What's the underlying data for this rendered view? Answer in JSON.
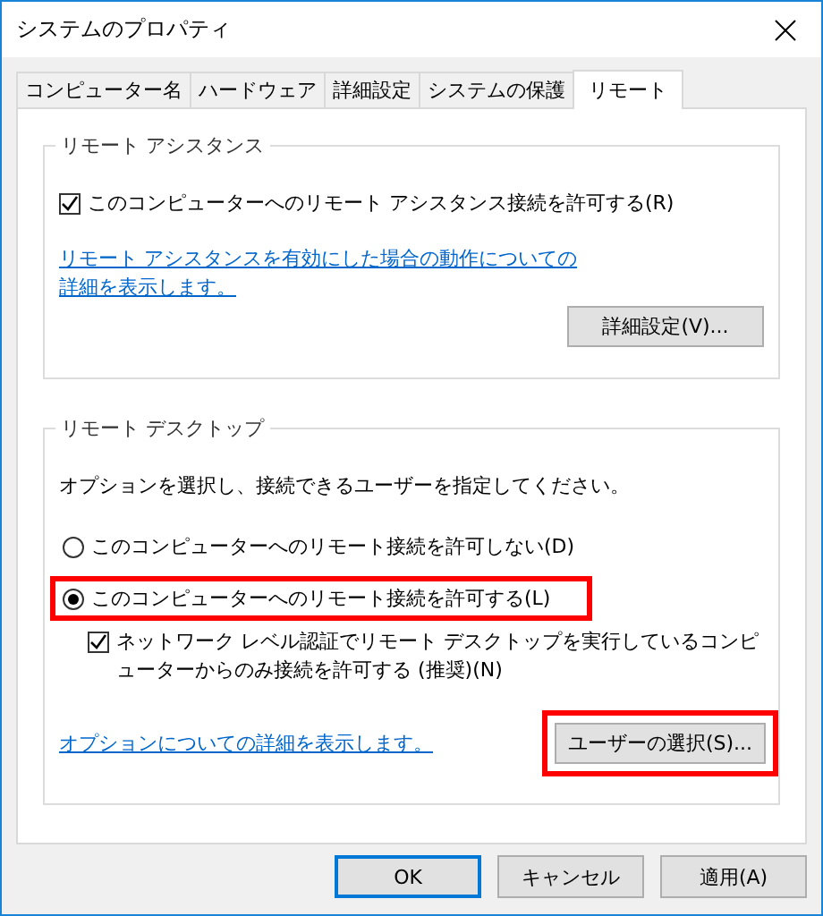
{
  "window": {
    "title": "システムのプロパティ"
  },
  "tabs": [
    {
      "label": "コンピューター名",
      "selected": false
    },
    {
      "label": "ハードウェア",
      "selected": false
    },
    {
      "label": "詳細設定",
      "selected": false
    },
    {
      "label": "システムの保護",
      "selected": false
    },
    {
      "label": "リモート",
      "selected": true
    }
  ],
  "remote_assistance": {
    "title": "リモート アシスタンス",
    "checkbox": {
      "label": "このコンピューターへのリモート アシスタンス接続を許可する(R)",
      "checked": true
    },
    "link": "リモート アシスタンスを有効にした場合の動作についての詳細を表示します。",
    "button": "詳細設定(V)..."
  },
  "remote_desktop": {
    "title": "リモート デスクトップ",
    "instruction": "オプションを選択し、接続できるユーザーを指定してください。",
    "options": [
      {
        "label": "このコンピューターへのリモート接続を許可しない(D)",
        "selected": false,
        "highlighted": false
      },
      {
        "label": "このコンピューターへのリモート接続を許可する(L)",
        "selected": true,
        "highlighted": true
      }
    ],
    "nla_checkbox": {
      "label": "ネットワーク レベル認証でリモート デスクトップを実行しているコンピューターからのみ接続を許可する (推奨)(N)",
      "checked": true
    },
    "link": "オプションについての詳細を表示します。",
    "button": {
      "label": "ユーザーの選択(S)...",
      "highlighted": true
    }
  },
  "buttons": [
    {
      "label": "OK",
      "default": true
    },
    {
      "label": "キャンセル",
      "default": false
    },
    {
      "label": "適用(A)",
      "default": false
    }
  ]
}
